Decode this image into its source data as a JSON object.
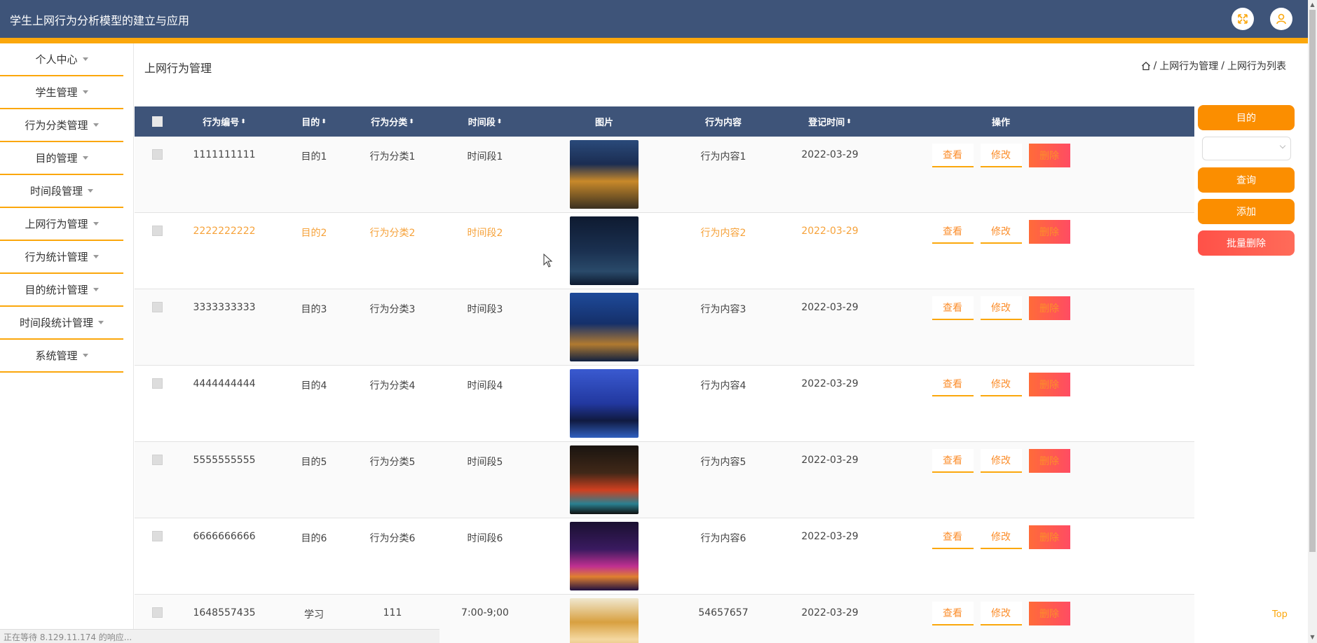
{
  "header": {
    "title": "学生上网行为分析模型的建立与应用",
    "fullscreen_icon": "expand-icon",
    "user_icon": "user-icon"
  },
  "sidebar": {
    "items": [
      {
        "label": "个人中心"
      },
      {
        "label": "学生管理"
      },
      {
        "label": "行为分类管理"
      },
      {
        "label": "目的管理"
      },
      {
        "label": "时间段管理"
      },
      {
        "label": "上网行为管理"
      },
      {
        "label": "行为统计管理"
      },
      {
        "label": "目的统计管理"
      },
      {
        "label": "时间段统计管理"
      },
      {
        "label": "系统管理"
      }
    ]
  },
  "page": {
    "title": "上网行为管理",
    "breadcrumb": [
      "上网行为管理",
      "上网行为列表"
    ],
    "breadcrumb_sep": "/"
  },
  "table": {
    "headers": {
      "id": "行为编号",
      "purpose": "目的",
      "category": "行为分类",
      "time": "时间段",
      "image": "图片",
      "content": "行为内容",
      "date": "登记时间",
      "ops": "操作"
    },
    "sort_glyph": "⬍",
    "rows": [
      {
        "id": "1111111111",
        "purpose": "目的1",
        "category": "行为分类1",
        "time": "时间段1",
        "content": "行为内容1",
        "date": "2022-03-29"
      },
      {
        "id": "2222222222",
        "purpose": "目的2",
        "category": "行为分类2",
        "time": "时间段2",
        "content": "行为内容2",
        "date": "2022-03-29"
      },
      {
        "id": "3333333333",
        "purpose": "目的3",
        "category": "行为分类3",
        "time": "时间段3",
        "content": "行为内容3",
        "date": "2022-03-29"
      },
      {
        "id": "4444444444",
        "purpose": "目的4",
        "category": "行为分类4",
        "time": "时间段4",
        "content": "行为内容4",
        "date": "2022-03-29"
      },
      {
        "id": "5555555555",
        "purpose": "目的5",
        "category": "行为分类5",
        "time": "时间段5",
        "content": "行为内容5",
        "date": "2022-03-29"
      },
      {
        "id": "6666666666",
        "purpose": "目的6",
        "category": "行为分类6",
        "time": "时间段6",
        "content": "行为内容6",
        "date": "2022-03-29"
      },
      {
        "id": "1648557435",
        "purpose": "学习",
        "category": "111",
        "time": "7:00-9;00",
        "content": "54657657",
        "date": "2022-03-29"
      }
    ],
    "ops": {
      "view": "查看",
      "edit": "修改",
      "delete": "删除"
    }
  },
  "right_panel": {
    "filter_label": "目的",
    "select_value": "",
    "search_label": "查询",
    "add_label": "添加",
    "batch_delete_label": "批量删除"
  },
  "footer": {
    "top_label": "Top",
    "status_text": "正在等待 8.129.11.174 的响应..."
  },
  "colors": {
    "header_bg": "#3e5479",
    "accent": "#fba70c",
    "button_orange": "#fb8e00",
    "button_red": "#ff5148",
    "highlight_row_text": "#f6a23a"
  }
}
